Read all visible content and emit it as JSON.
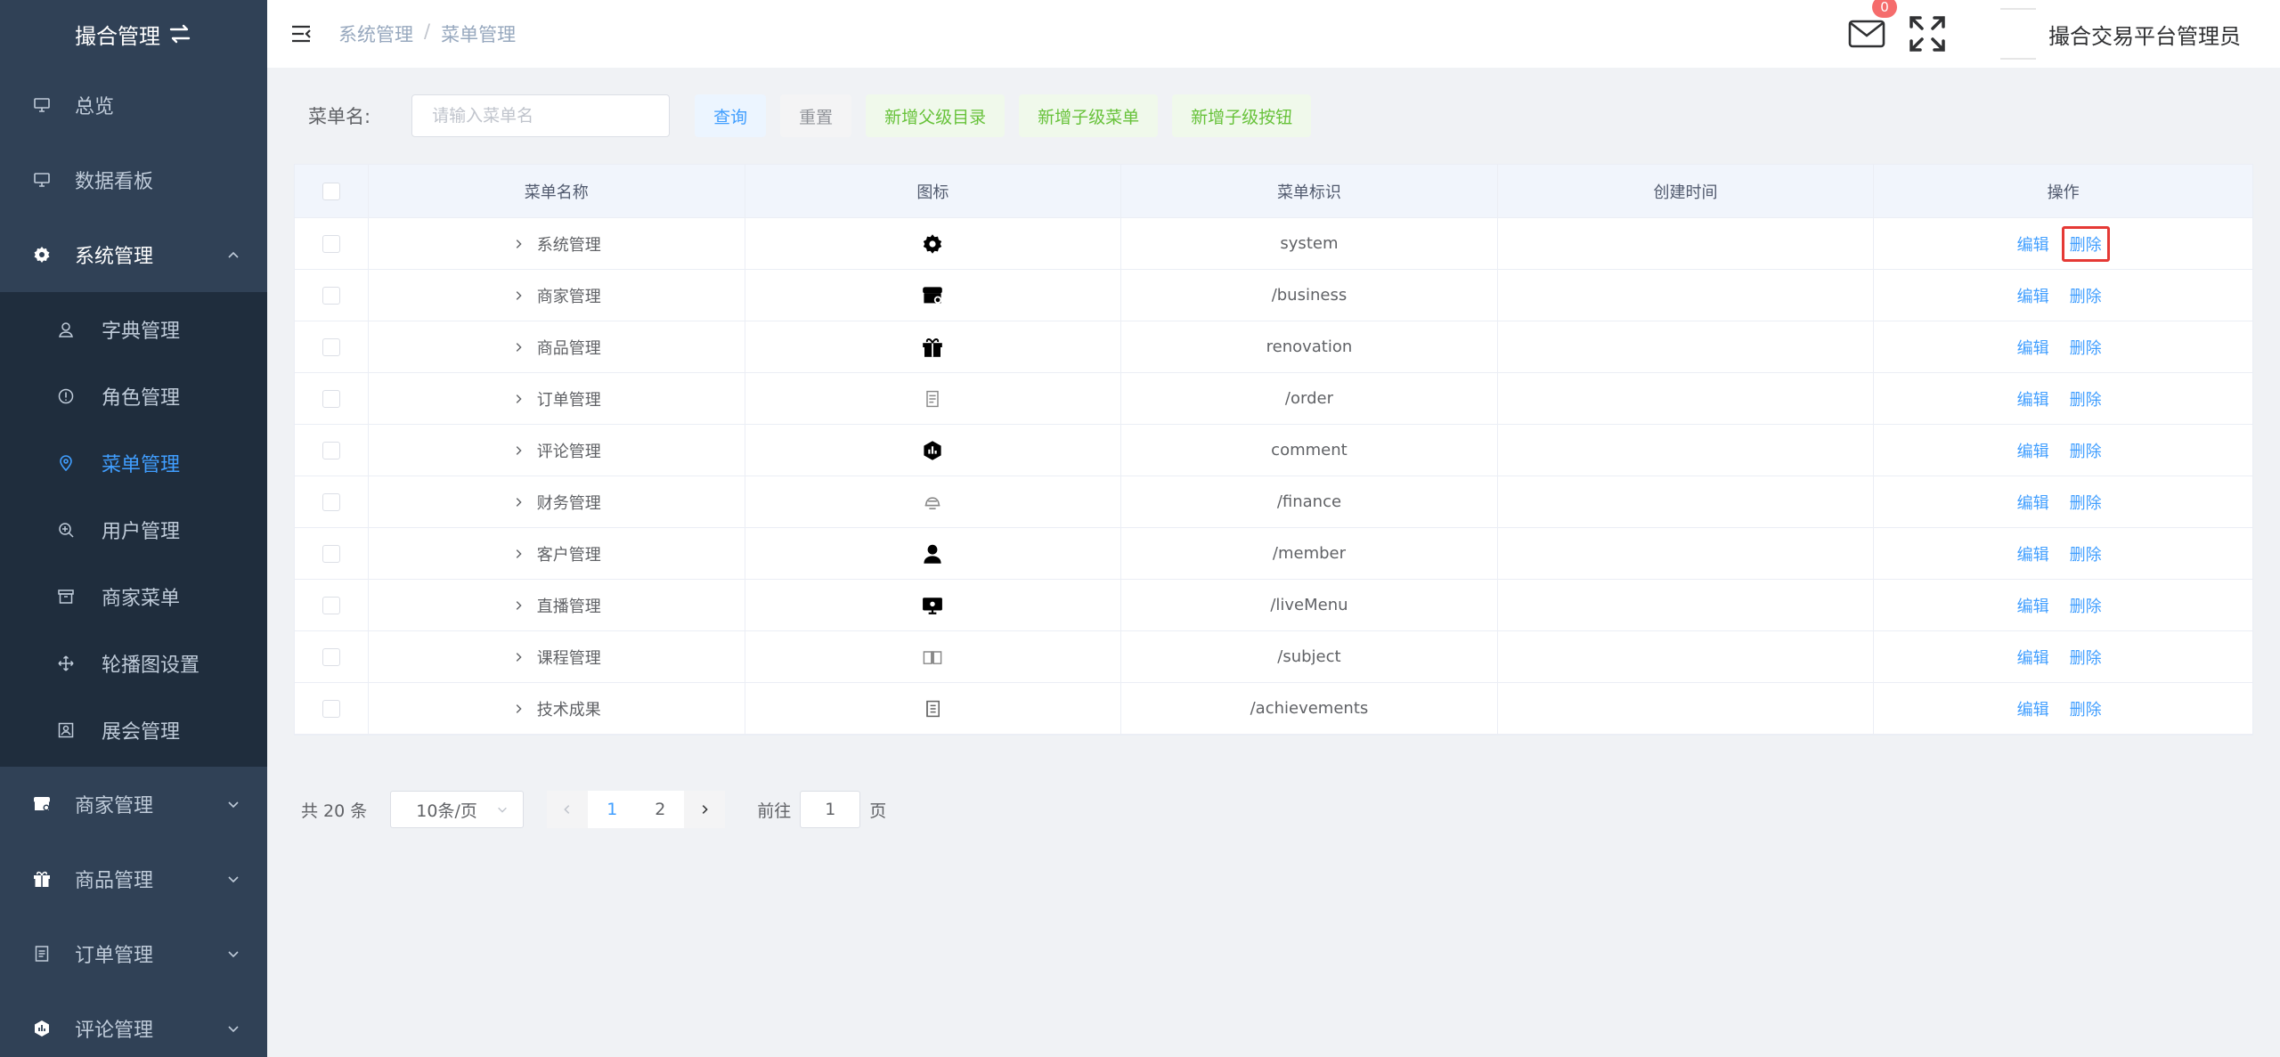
{
  "app": {
    "title": "撮合管理",
    "user_name": "撮合交易平台管理员",
    "unread_count": "0"
  },
  "colors": {
    "sidebar_bg": "#304156",
    "submenu_bg": "#1f2d3d",
    "active": "#409eff",
    "highlight_border": "#e53935"
  },
  "breadcrumb": [
    "系统管理",
    "菜单管理"
  ],
  "sidebar": {
    "items": [
      {
        "label": "总览",
        "icon": "monitor-icon"
      },
      {
        "label": "数据看板",
        "icon": "monitor-icon"
      },
      {
        "label": "系统管理",
        "icon": "gear-icon",
        "expanded": true
      }
    ],
    "sub_items": [
      {
        "label": "字典管理",
        "icon": "user-icon"
      },
      {
        "label": "角色管理",
        "icon": "info-circle-icon"
      },
      {
        "label": "菜单管理",
        "icon": "location-pin-icon",
        "active": true
      },
      {
        "label": "用户管理",
        "icon": "zoom-in-icon"
      },
      {
        "label": "商家菜单",
        "icon": "box-icon"
      },
      {
        "label": "轮播图设置",
        "icon": "move-icon"
      },
      {
        "label": "展会管理",
        "icon": "picture-icon"
      }
    ],
    "more_items": [
      {
        "label": "商家管理",
        "icon": "shop-icon"
      },
      {
        "label": "商品管理",
        "icon": "gift-icon"
      },
      {
        "label": "订单管理",
        "icon": "document-icon"
      },
      {
        "label": "评论管理",
        "icon": "chart-hexagon-icon"
      }
    ]
  },
  "search": {
    "label": "菜单名:",
    "placeholder": "请输入菜单名",
    "value": "",
    "buttons": {
      "query": "查询",
      "reset": "重置",
      "add_parent": "新增父级目录",
      "add_child_menu": "新增子级菜单",
      "add_child_button": "新增子级按钮"
    }
  },
  "table": {
    "headers": [
      "菜单名称",
      "图标",
      "菜单标识",
      "创建时间",
      "操作"
    ],
    "edit_label": "编辑",
    "delete_label": "删除",
    "rows": [
      {
        "name": "系统管理",
        "icon": "gear-icon",
        "key": "system",
        "created": ""
      },
      {
        "name": "商家管理",
        "icon": "shop-icon",
        "key": "/business",
        "created": ""
      },
      {
        "name": "商品管理",
        "icon": "gift-icon",
        "key": "renovation",
        "created": ""
      },
      {
        "name": "订单管理",
        "icon": "document-icon",
        "key": "/order",
        "created": ""
      },
      {
        "name": "评论管理",
        "icon": "chart-hexagon-icon",
        "key": "comment",
        "created": ""
      },
      {
        "name": "财务管理",
        "icon": "coins-icon",
        "key": "/finance",
        "created": ""
      },
      {
        "name": "客户管理",
        "icon": "person-icon",
        "key": "/member",
        "created": ""
      },
      {
        "name": "直播管理",
        "icon": "live-monitor-icon",
        "key": "/liveMenu",
        "created": ""
      },
      {
        "name": "课程管理",
        "icon": "book-icon",
        "key": "/subject",
        "created": ""
      },
      {
        "name": "技术成果",
        "icon": "notebook-icon",
        "key": "/achievements",
        "created": ""
      }
    ]
  },
  "pagination": {
    "total": "共 20 条",
    "page_size": "10条/页",
    "pages": [
      "1",
      "2"
    ],
    "current": "1",
    "goto_label": "前往",
    "goto_value": "1",
    "page_suffix": "页"
  }
}
